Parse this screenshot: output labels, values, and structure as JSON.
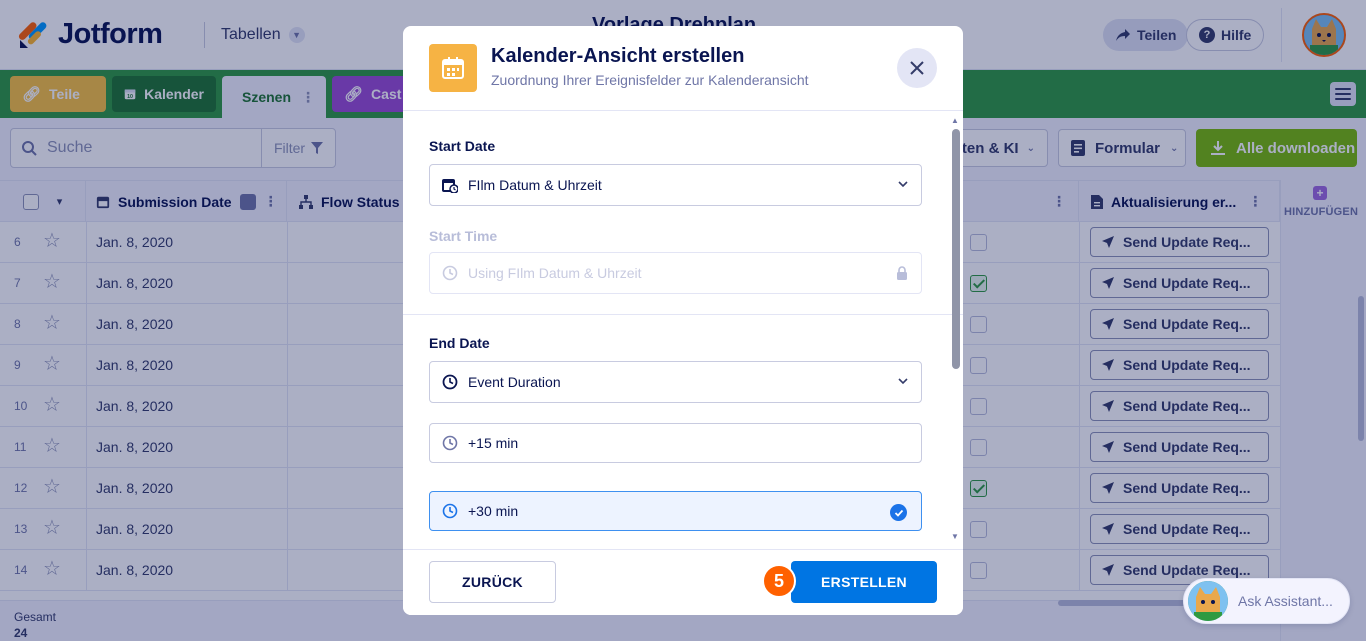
{
  "header": {
    "logo_text": "Jotform",
    "tables_label": "Tabellen",
    "form_title": "Vorlage Drehplan",
    "share_label": "Teilen",
    "help_label": "Hilfe"
  },
  "tabs": [
    {
      "label": "Teile",
      "icon": "link-icon"
    },
    {
      "label": "Kalender",
      "icon": "calendar-icon"
    },
    {
      "label": "Szenen",
      "icon": "grid-icon"
    },
    {
      "label": "Cast",
      "icon": "link-icon"
    }
  ],
  "toolbar": {
    "search_placeholder": "Suche",
    "filter_label": "Filter",
    "ki_label": "lten & KI",
    "form_label": "Formular",
    "download_label": "Alle downloaden"
  },
  "table": {
    "columns": {
      "submission_date": "Submission Date",
      "flow_status": "Flow Status",
      "update": "Aktualisierung er..."
    },
    "add_column_label": "HINZUFÜGEN",
    "rows": [
      {
        "num": "6",
        "date": "Jan. 8, 2020",
        "checked": false,
        "action": "Send Update Req..."
      },
      {
        "num": "7",
        "date": "Jan. 8, 2020",
        "checked": true,
        "action": "Send Update Req..."
      },
      {
        "num": "8",
        "date": "Jan. 8, 2020",
        "checked": false,
        "action": "Send Update Req..."
      },
      {
        "num": "9",
        "date": "Jan. 8, 2020",
        "checked": false,
        "action": "Send Update Req..."
      },
      {
        "num": "10",
        "date": "Jan. 8, 2020",
        "checked": false,
        "action": "Send Update Req..."
      },
      {
        "num": "11",
        "date": "Jan. 8, 2020",
        "checked": false,
        "action": "Send Update Req..."
      },
      {
        "num": "12",
        "date": "Jan. 8, 2020",
        "checked": true,
        "action": "Send Update Req..."
      },
      {
        "num": "13",
        "date": "Jan. 8, 2020",
        "checked": false,
        "action": "Send Update Req..."
      },
      {
        "num": "14",
        "date": "Jan. 8, 2020",
        "checked": false,
        "action": "Send Update Req..."
      }
    ],
    "total_label": "Gesamt",
    "total_value": "24"
  },
  "modal": {
    "title": "Kalender-Ansicht erstellen",
    "subtitle": "Zuordnung Ihrer Ereignisfelder zur Kalenderansicht",
    "start_date_label": "Start Date",
    "start_date_value": "FIlm Datum & Uhrzeit",
    "start_time_label": "Start Time",
    "start_time_value": "Using FIlm Datum & Uhrzeit",
    "end_date_label": "End Date",
    "end_date_value": "Event Duration",
    "duration_options": [
      "+15 min",
      "+30 min"
    ],
    "selected_option": "+30 min",
    "back_label": "ZURÜCK",
    "create_label": "ERSTELLEN",
    "step_number": "5"
  },
  "assistant": {
    "label": "Ask Assistant..."
  },
  "colors": {
    "tab_bar": "#2f9a41",
    "primary_button": "#0075e3",
    "download_button": "#78bb07",
    "step_badge": "#ff6100",
    "modal_icon_bg": "#f6b344"
  }
}
